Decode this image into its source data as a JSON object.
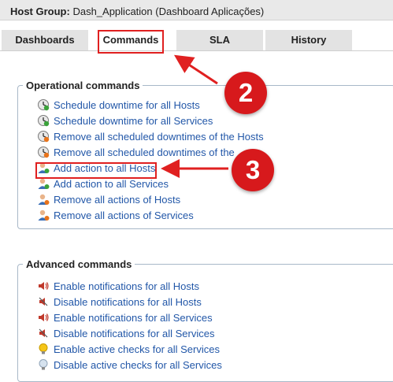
{
  "header": {
    "label": "Host Group:",
    "value": "Dash_Application (Dashboard Aplicações)"
  },
  "tabs": [
    {
      "label": "Dashboards",
      "active": false
    },
    {
      "label": "Commands",
      "active": true
    },
    {
      "label": "SLA",
      "active": false
    },
    {
      "label": "History",
      "active": false
    }
  ],
  "operational": {
    "legend": "Operational commands",
    "items": [
      {
        "label": "Schedule downtime for all Hosts",
        "icon": "clock-icon"
      },
      {
        "label": "Schedule downtime for all Services",
        "icon": "clock-icon"
      },
      {
        "label": "Remove all scheduled downtimes of the Hosts",
        "icon": "clock-remove-icon"
      },
      {
        "label": "Remove all scheduled downtimes of the",
        "icon": "clock-remove-icon"
      },
      {
        "label": "Add action to all Hosts",
        "icon": "user-add-icon"
      },
      {
        "label": "Add action to all Services",
        "icon": "user-add-icon"
      },
      {
        "label": "Remove all actions of Hosts",
        "icon": "user-remove-icon"
      },
      {
        "label": "Remove all actions of Services",
        "icon": "user-remove-icon"
      }
    ]
  },
  "advanced": {
    "legend": "Advanced commands",
    "items": [
      {
        "label": "Enable notifications for all Hosts",
        "icon": "speaker-on-icon"
      },
      {
        "label": "Disable notifications for all Hosts",
        "icon": "speaker-off-icon"
      },
      {
        "label": "Enable notifications for all Services",
        "icon": "speaker-on-icon"
      },
      {
        "label": "Disable notifications for all Services",
        "icon": "speaker-off-icon"
      },
      {
        "label": "Enable active checks for all Services",
        "icon": "bulb-on-icon"
      },
      {
        "label": "Disable active checks for all Services",
        "icon": "bulb-off-icon"
      }
    ]
  },
  "annotations": {
    "badge_commands": "2",
    "badge_add_action": "3",
    "highlight_color": "#e02020"
  },
  "colors": {
    "link": "#2257a8",
    "tab_bg": "#e3e3e3",
    "header_bg": "#e9e9e9",
    "badge": "#d7191c"
  }
}
